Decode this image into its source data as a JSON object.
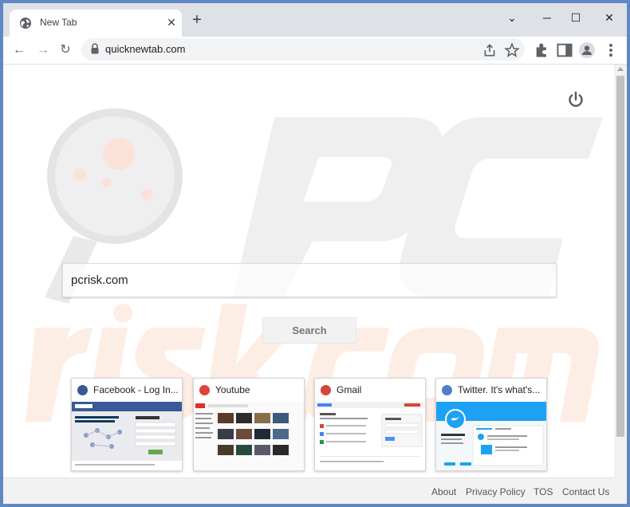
{
  "browser": {
    "tab_title": "New Tab",
    "tab_close": "✕",
    "new_tab": "+",
    "minimize": "⌄",
    "restore": "─",
    "maximize": "☐",
    "close": "✕",
    "url": "quicknewtab.com"
  },
  "nav": {
    "back": "←",
    "forward": "→",
    "reload": "↻"
  },
  "search": {
    "value": "pcrisk.com",
    "button_label": "Search"
  },
  "tiles": [
    {
      "title": "Facebook - Log In...",
      "icon_color": "#3b5998",
      "icon_glyph": "f"
    },
    {
      "title": "Youtube",
      "icon_color": "#e0433b",
      "icon_glyph": "▶"
    },
    {
      "title": "Gmail",
      "icon_color": "#d44638",
      "icon_glyph": "M"
    },
    {
      "title": "Twitter. It's what's...",
      "icon_color": "#4d7fc8",
      "icon_glyph": "t"
    }
  ],
  "footer": {
    "about": "About",
    "privacy": "Privacy Policy",
    "tos": "TOS",
    "contact": "Contact Us"
  },
  "colors": {
    "frame": "#dee1e6",
    "accent": "#1a73e8",
    "watermark_gray": "#ececec",
    "watermark_orange": "#fde8dc"
  }
}
